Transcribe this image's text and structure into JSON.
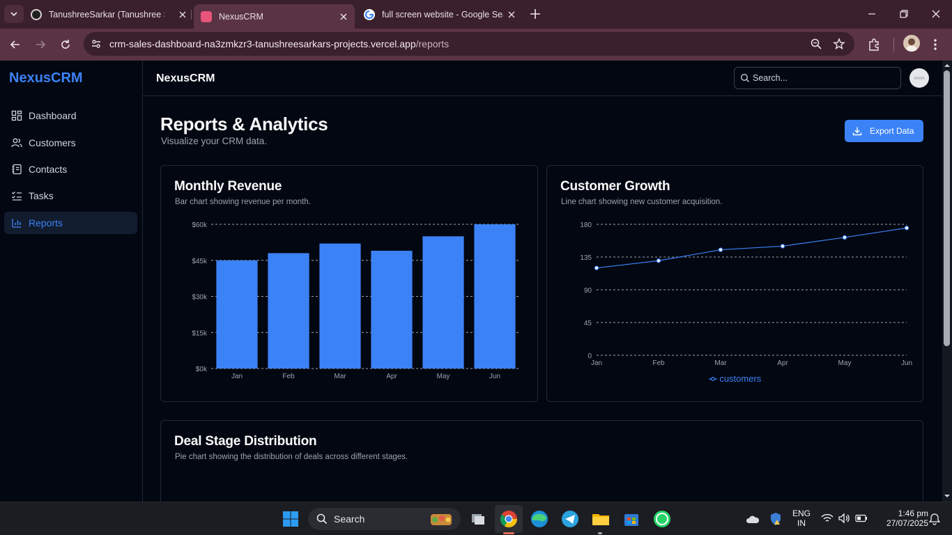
{
  "browser": {
    "tabs": [
      {
        "title": "TanushreeSarkar (Tanushree Sar",
        "favicon": "github-icon"
      },
      {
        "title": "NexusCRM",
        "favicon": "nexuscrm-icon",
        "active": true
      },
      {
        "title": "full screen website - Google Sea",
        "favicon": "google-icon"
      }
    ],
    "url_host": "crm-sales-dashboard-na3zmkzr3-tanushreesarkars-projects.vercel.app",
    "url_path": "/reports"
  },
  "app": {
    "brand": "NexusCRM",
    "header_title": "NexusCRM",
    "search_placeholder": "Search...",
    "nav": [
      {
        "label": "Dashboard",
        "icon": "dashboard-icon"
      },
      {
        "label": "Customers",
        "icon": "users-icon"
      },
      {
        "label": "Contacts",
        "icon": "contacts-book-icon"
      },
      {
        "label": "Tasks",
        "icon": "task-list-icon"
      },
      {
        "label": "Reports",
        "icon": "bar-chart-icon",
        "active": true
      }
    ],
    "accent": "#3b82f6"
  },
  "page": {
    "title": "Reports & Analytics",
    "subtitle": "Visualize your CRM data.",
    "export_label": "Export Data"
  },
  "cards": {
    "revenue": {
      "title": "Monthly Revenue",
      "desc": "Bar chart showing revenue per month."
    },
    "growth": {
      "title": "Customer Growth",
      "desc": "Line chart showing new customer acquisition."
    },
    "deals": {
      "title": "Deal Stage Distribution",
      "desc": "Pie chart showing the distribution of deals across different stages."
    }
  },
  "chart_data": [
    {
      "type": "bar",
      "title": "Monthly Revenue",
      "categories": [
        "Jan",
        "Feb",
        "Mar",
        "Apr",
        "May",
        "Jun"
      ],
      "values": [
        45000,
        48000,
        52000,
        49000,
        55000,
        60000
      ],
      "ylim": [
        0,
        60000
      ],
      "yticks": [
        0,
        15000,
        30000,
        45000,
        60000
      ],
      "ytick_labels": [
        "$0k",
        "$15k",
        "$30k",
        "$45k",
        "$60k"
      ],
      "grid": true,
      "color": "#3b82f6"
    },
    {
      "type": "line",
      "title": "Customer Growth",
      "categories": [
        "Jan",
        "Feb",
        "Mar",
        "Apr",
        "May",
        "Jun"
      ],
      "series": [
        {
          "name": "customers",
          "values": [
            120,
            130,
            145,
            150,
            162,
            175
          ]
        }
      ],
      "ylim": [
        0,
        180
      ],
      "yticks": [
        0,
        45,
        90,
        135,
        180
      ],
      "ytick_labels": [
        "0",
        "45",
        "90",
        "135",
        "180"
      ],
      "grid": true,
      "legend": "bottom",
      "color": "#3b82f6"
    }
  ],
  "taskbar": {
    "search_label": "Search",
    "lang_top": "ENG",
    "lang_bottom": "IN",
    "time": "1:46 pm",
    "date": "27/07/2025"
  }
}
